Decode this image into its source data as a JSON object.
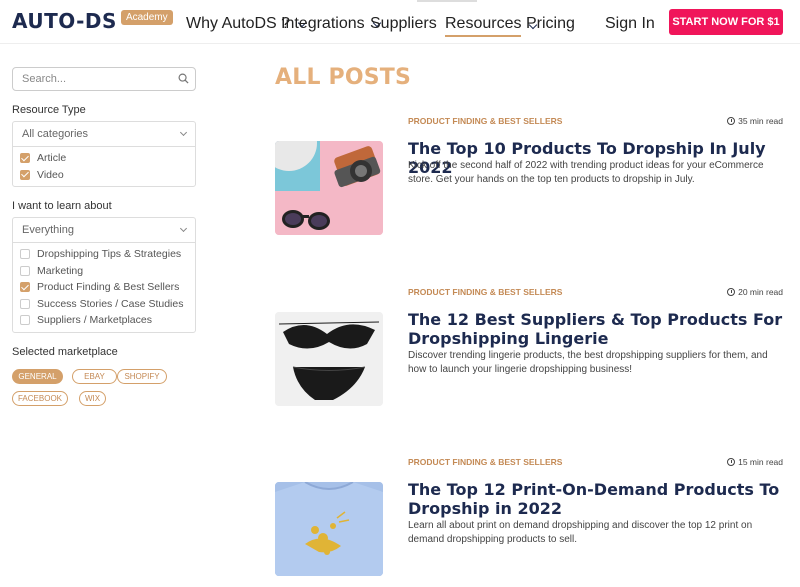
{
  "header": {
    "logo_text": "AUTO-DS",
    "logo_badge": "Academy",
    "nav": [
      {
        "label": "Why AutoDS ?",
        "has_chevron": true
      },
      {
        "label": "Integrations",
        "has_chevron": true
      },
      {
        "label": "Suppliers",
        "has_chevron": false
      },
      {
        "label": "Resources",
        "has_chevron": true
      },
      {
        "label": "Pricing",
        "has_chevron": false
      }
    ],
    "sign_in": "Sign In",
    "cta": "START NOW FOR $1"
  },
  "sidebar": {
    "search_placeholder": "Search...",
    "resource_type_label": "Resource Type",
    "resource_select": "All categories",
    "resource_options": [
      {
        "label": "Article",
        "checked": true
      },
      {
        "label": "Video",
        "checked": true
      }
    ],
    "learn_label": "I want to learn about",
    "learn_select": "Everything",
    "learn_options": [
      {
        "label": "Dropshipping Tips & Strategies",
        "checked": false
      },
      {
        "label": "Marketing",
        "checked": false
      },
      {
        "label": "Product Finding & Best Sellers",
        "checked": true
      },
      {
        "label": "Success Stories / Case Studies",
        "checked": false
      },
      {
        "label": "Suppliers / Marketplaces",
        "checked": false
      }
    ],
    "marketplace_label": "Selected marketplace",
    "marketplaces": [
      {
        "label": "GENERAL",
        "active": true
      },
      {
        "label": "EBAY",
        "active": false
      },
      {
        "label": "SHOPIFY",
        "active": false
      },
      {
        "label": "FACEBOOK",
        "active": false
      },
      {
        "label": "WIX",
        "active": false
      }
    ]
  },
  "main": {
    "title": "ALL POSTS",
    "posts": [
      {
        "category": "PRODUCT FINDING & BEST SELLERS",
        "read_time": "35 min read",
        "title": "The Top 10 Products To Dropship In July 2022",
        "description": "Kick off the second half of 2022 with trending product ideas for your eCommerce store. Get your hands on the top ten products to dropship in July."
      },
      {
        "category": "PRODUCT FINDING & BEST SELLERS",
        "read_time": "20 min read",
        "title": "The 12 Best Suppliers & Top Products For Dropshipping Lingerie",
        "description": "Discover trending lingerie products, the best dropshipping suppliers for them, and how to launch your lingerie dropshipping business!"
      },
      {
        "category": "PRODUCT FINDING & BEST SELLERS",
        "read_time": "15 min read",
        "title": "The Top 12 Print-On-Demand Products To Dropship in 2022",
        "description": "Learn all about print on demand dropshipping and discover the top 12 print on demand dropshipping products to sell."
      }
    ]
  },
  "colors": {
    "accent": "#d4a06a",
    "title": "#e5b07c",
    "cta": "#f0155a",
    "navy": "#1d2a4f"
  }
}
